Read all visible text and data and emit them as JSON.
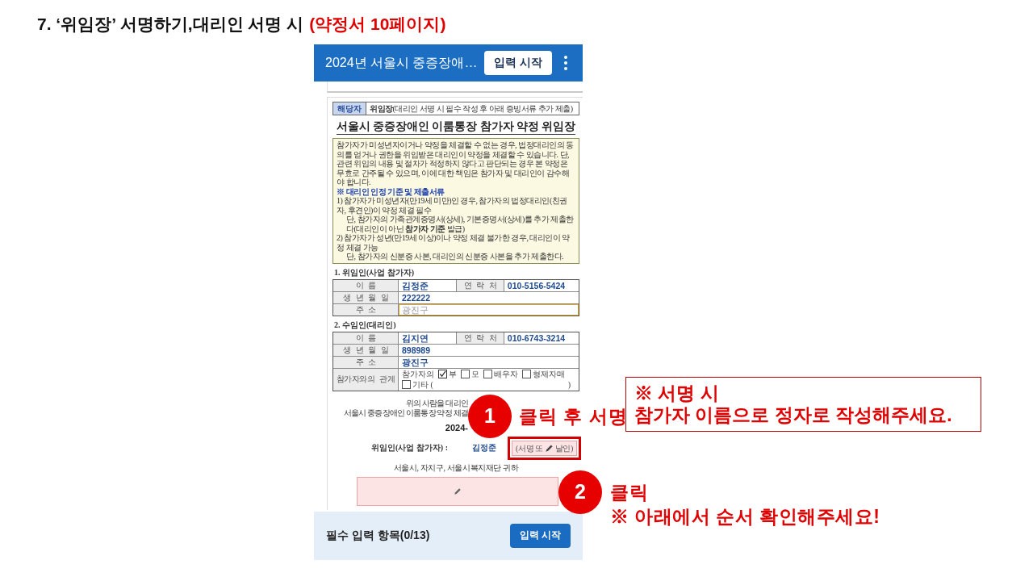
{
  "slide": {
    "title": "7. ‘위임장’ 서명하기,대리인 서명 시",
    "title_note": "(약정서 10페이지)"
  },
  "app_bar": {
    "title": "2024년 서울시 중증장애…",
    "button": "입력 시작"
  },
  "document": {
    "applicability": {
      "label": "해당자",
      "text": "**위임장**(대리인 서명 시 필수 작성 후 아래 증빙서류 추가 제출)"
    },
    "title": "서울시 중증장애인 이룸통장 참가자 약정 위임장",
    "notice": {
      "paragraph": "참가자가 미성년자이거나 약정을 체결할 수 없는 경우, 법정대리인의 동의를 얻거나 권한을 위임받은 대리인이 약정을 체결할 수 있습니다. 단, 관련 위임의 내용 및 절차가 적정하지 않다고 판단되는 경우 본 약정은 무효로 간주될 수 있으며, 이에 대한 책임은 참가자 및 대리인이 감수해야 합니다.",
      "heading": "※ 대리인 인정 기준 및 제출서류",
      "items": [
        {
          "text": "1) 참가자가 미성년자(만19세 미만)인 경우, 참가자의 법정대리인(친권자, 후견인)이 약정 체결 필수",
          "children": [
            "단, 참가자의 가족관계증명서(상세), 기본증명서(상세)를 추가 제출한다(대리인이 아닌 **참가자 기준** 발급)"
          ]
        },
        {
          "text": "2) 참가자가 성년(만19세 이상)이나 약정 체결 불가한 경우, 대리인이 약정 체결 가능",
          "children": [
            "단, 참가자의 신분증 사본, 대리인의 신분증 사본을 추가 제출한다."
          ]
        }
      ]
    },
    "sections": [
      {
        "heading": "1. 위임인(사업 참가자)",
        "rows": [
          {
            "kind": "double",
            "label": "이 름",
            "value": "김정준",
            "label2": "연 락 처",
            "value2": "010-5156-5424"
          },
          {
            "kind": "single",
            "label": "생 년 월 일",
            "value": "222222"
          },
          {
            "kind": "input",
            "label": "주 소",
            "placeholder": "광진구",
            "focused": true
          }
        ]
      },
      {
        "heading": "2. 수임인(대리인)",
        "rows": [
          {
            "kind": "double",
            "label": "이 름",
            "value": "김지연",
            "label2": "연 락 처",
            "value2": "010-6743-3214"
          },
          {
            "kind": "single",
            "label": "생 년 월 일",
            "value": "898989"
          },
          {
            "kind": "single",
            "label": "주 소",
            "value": "광진구"
          },
          {
            "kind": "relation",
            "label": "참가자와의 관계",
            "prefix": "참가자의",
            "options": [
              {
                "label": "부",
                "checked": true
              },
              {
                "label": "모",
                "checked": false
              },
              {
                "label": "배우자",
                "checked": false
              },
              {
                "label": "형제자매",
                "checked": false
              },
              {
                "label": "기타 (",
                "checked": false
              }
            ],
            "suffix": ")"
          }
        ]
      }
    ],
    "statement_lines": [
      "위의 사람을 대리인",
      "서울시 중증장애인 이룸통장 약정 체결"
    ],
    "date": "2024-",
    "signer": {
      "label": "위임인(사업 참가자) :",
      "name": "김정준",
      "signature_field": [
        "(서명 또",
        "날인)"
      ]
    },
    "addressee": "서울시, 자치구, 서울시복지재단 귀하"
  },
  "bottom_bar": {
    "label": "필수 입력 항목(0/13)",
    "button": "입력 시작"
  },
  "annotations": {
    "step1": {
      "number": "1",
      "text": "클릭 후 서명"
    },
    "note": [
      "※ 서명 시",
      "참가자 이름으로 정자로 작성해주세요."
    ],
    "step2": {
      "number": "2",
      "lines": [
        "클릭",
        "※ 아래에서 순서 확인해주세요!"
      ]
    }
  }
}
